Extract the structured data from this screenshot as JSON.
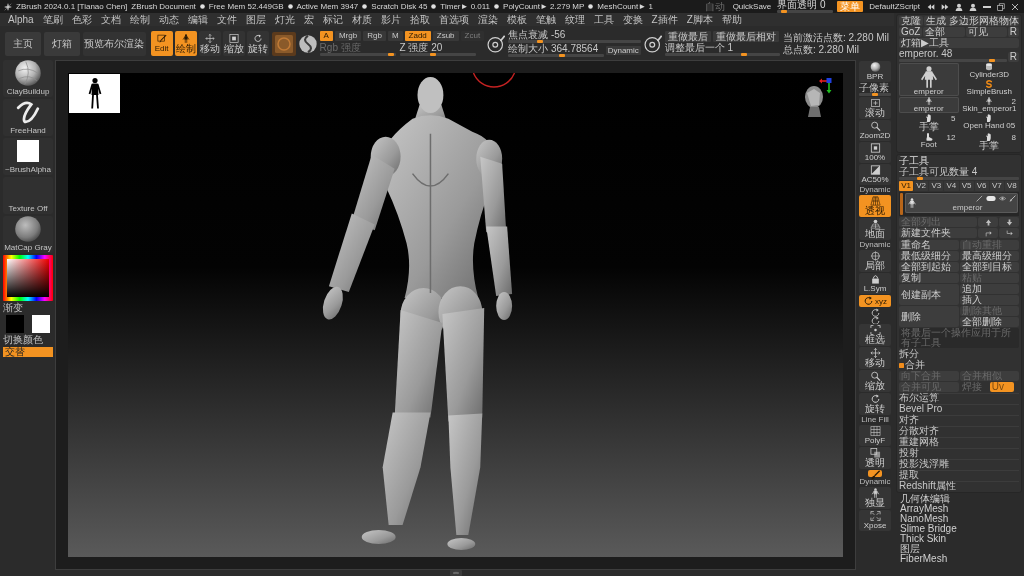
{
  "title_bar": {
    "app": "ZBrush 2024.0.1 [Tianao Chen]",
    "document": "ZBrush Document",
    "stats": [
      "Free Mem 52.449GB",
      "Active Mem 3947",
      "Scratch Disk 45",
      "Timer► 0.011",
      "PolyCount► 2.279 MP",
      "MeshCount► 1"
    ],
    "autosave": {
      "label": "自动",
      "disabled": true
    },
    "quicksave": "QuickSave",
    "transparency": {
      "label": "界面透明 0",
      "level": 0.07
    },
    "menu_button": {
      "label": "菜单",
      "selected": true
    },
    "script": "DefaultZScript"
  },
  "menus": [
    "Alpha",
    "笔刷",
    "色彩",
    "文档",
    "绘制",
    "动态",
    "编辑",
    "文件",
    "图层",
    "灯光",
    "宏",
    "标记",
    "材质",
    "影片",
    "拾取",
    "首选项",
    "渲染",
    "模板",
    "笔触",
    "纹理",
    "工具",
    "变换",
    "Z插件",
    "Z脚本",
    "帮助"
  ],
  "top_shelf": {
    "buttons": [
      "主页",
      "灯箱",
      "预览布尔渲染"
    ],
    "modes": [
      {
        "kind": "edit",
        "label": "Edit",
        "selected": true
      },
      {
        "kind": "draw",
        "label": "绘制",
        "selected": true
      },
      {
        "kind": "move",
        "label": "移动",
        "selected": false
      },
      {
        "kind": "scale",
        "label": "缩放",
        "selected": false
      },
      {
        "kind": "rotate",
        "label": "旋转",
        "selected": false
      }
    ],
    "channels": [
      {
        "label": "A",
        "selected": true
      },
      {
        "label": "Mrgb",
        "selected": false
      },
      {
        "label": "Rgb",
        "selected": false
      },
      {
        "label": "M",
        "selected": false
      }
    ],
    "z_modes": [
      {
        "label": "Zadd",
        "selected": true,
        "disabled": false
      },
      {
        "label": "Zsub",
        "selected": false,
        "disabled": false
      },
      {
        "label": "Zcut",
        "selected": false,
        "disabled": true
      }
    ],
    "rgb_intensity": {
      "label": "Rgb 强度",
      "level": 0.97,
      "disabled": true
    },
    "z_intensity": {
      "label": "Z 强度 20",
      "level": 0.43,
      "disabled": false
    },
    "focal_shift": {
      "label": "焦点衰减 -56",
      "level": 0.23
    },
    "draw_size": {
      "label": "绘制大小 364.78564",
      "level": 0.57
    },
    "dynamic": {
      "label": "Dynamic",
      "on": false
    },
    "redo": [
      "重做最后",
      "重做最后相对"
    ],
    "tweak_last": {
      "label": "调整最后一个 1",
      "level": 0.7
    },
    "active_points": "当前激活点数: 2.280 Mil",
    "total_points": "总点数: 2.280 Mil"
  },
  "left_shelf": {
    "brush": "ClayBuildup",
    "stroke": "FreeHand",
    "alpha": "~BrushAlpha",
    "texture": "Texture Off",
    "material": "MatCap Gray",
    "gradient": "渐变",
    "switch_color": "切换颜色",
    "alternate": {
      "label": "交替",
      "on": true
    }
  },
  "right_shelf": [
    {
      "kind": "bpr",
      "label": "BPR",
      "selected": false,
      "slider": {
        "label": "子像素",
        "level": 0.5
      }
    },
    {
      "kind": "scroll",
      "label": "滚动",
      "selected": false
    },
    {
      "kind": "zoom",
      "label": "Zoom2D",
      "selected": false
    },
    {
      "kind": "actual",
      "label": "100%",
      "selected": false
    },
    {
      "kind": "aahalf",
      "label": "AC50%",
      "selected": false
    },
    {
      "kind": "persp",
      "caption": "Dynamic",
      "label": "透视",
      "selected": true
    },
    {
      "kind": "floor",
      "label": "地面",
      "selected": false
    },
    {
      "kind": "local",
      "caption": "Dynamic",
      "label": "局部",
      "selected": false
    },
    {
      "kind": "lsym",
      "label": "L.Sym",
      "selected": false
    },
    {
      "kind": "xyz",
      "label": "xyz",
      "selected": true
    },
    {
      "kind": "rot-y",
      "selected": false
    },
    {
      "kind": "rot-z",
      "selected": false
    },
    {
      "kind": "frame",
      "label": "框选",
      "selected": false
    },
    {
      "kind": "move",
      "label": "移动",
      "selected": false
    },
    {
      "kind": "zoom3d",
      "label": "缩放",
      "selected": false
    },
    {
      "kind": "rotate",
      "label": "旋转",
      "selected": false
    },
    {
      "kind": "polyf",
      "caption": "Line Fill",
      "label": "PolyF",
      "selected": false
    },
    {
      "kind": "transp",
      "label": "透明",
      "selected": false
    },
    {
      "kind": "ghost",
      "selected": true
    },
    {
      "kind": "solo",
      "caption": "Dynamic",
      "label": "独显",
      "selected": false
    },
    {
      "kind": "xpose",
      "label": "Xpose",
      "selected": false
    }
  ],
  "tool_panel": {
    "clone": "克隆",
    "make_polymesh": "生成 多边形网格物体",
    "goz": "GoZ",
    "all": "全部",
    "visible": "可见",
    "goz_r": "R",
    "lightbox": "灯箱▶工具",
    "tool_slider": {
      "label": "emperor. 48",
      "level": 0.88
    },
    "slider_r": "R",
    "tools": [
      {
        "kind": "figure",
        "label": "emperor",
        "selected": true
      },
      {
        "kind": "cylinder",
        "label": "Cylinder3D",
        "selected": false
      },
      {
        "kind": "simplebrush",
        "label": "SimpleBrush",
        "selected": false
      },
      {
        "kind": "figure",
        "label": "emperor",
        "selected": true
      },
      {
        "kind": "figure",
        "label": "Skin_emperor1",
        "count": "2",
        "selected": false
      },
      {
        "kind": "hand",
        "label": "手掌",
        "count": "5",
        "selected": false
      },
      {
        "kind": "hand",
        "label": "Open Hand 05",
        "selected": false
      },
      {
        "kind": "foot",
        "label": "Foot",
        "count": "12",
        "selected": false
      },
      {
        "kind": "hand",
        "label": "手掌",
        "count": "8",
        "selected": false
      }
    ]
  },
  "subtool_panel": {
    "title": "子工具",
    "visible_count": {
      "label": "子工具可见数量 4",
      "level": 0.16
    },
    "versions": [
      {
        "label": "V1",
        "selected": true
      },
      {
        "label": "V2",
        "selected": false
      },
      {
        "label": "V3",
        "selected": false
      },
      {
        "label": "V4",
        "selected": false
      },
      {
        "label": "V5",
        "selected": false
      },
      {
        "label": "V6",
        "selected": false
      },
      {
        "label": "V7",
        "selected": false
      },
      {
        "label": "V8",
        "selected": false
      }
    ],
    "subtools": [
      {
        "name": "emperor",
        "selected": true
      }
    ],
    "list_all": {
      "label": "全部列出",
      "disabled": true
    },
    "new_folder": "新建文件夹",
    "actions": [
      {
        "kind": "normal",
        "label": "重命名",
        "disabled": false
      },
      {
        "kind": "normal",
        "label": "自动重排",
        "disabled": true
      },
      {
        "kind": "normal",
        "label": "最低级细分",
        "disabled": false
      },
      {
        "kind": "normal",
        "label": "最高级细分",
        "disabled": false
      },
      {
        "kind": "normal",
        "label": "全部到起始",
        "disabled": false
      },
      {
        "kind": "normal",
        "label": "全部到目标",
        "disabled": false
      },
      {
        "kind": "normal",
        "label": "复制",
        "disabled": false
      },
      {
        "kind": "normal",
        "label": "粘贴",
        "disabled": true
      },
      {
        "kind": "tall",
        "label": "创建副本",
        "disabled": false
      },
      {
        "kind": "normal",
        "label": "追加",
        "disabled": false
      },
      {
        "kind": "normal",
        "label": "插入",
        "disabled": false
      },
      {
        "kind": "tall",
        "label": "删除",
        "disabled": false
      },
      {
        "kind": "normal",
        "label": "删除其他",
        "disabled": true
      },
      {
        "kind": "normal",
        "label": "全部删除",
        "disabled": false
      }
    ],
    "apply_all": {
      "label": "将最后一个操作应用于所有子工具",
      "disabled": true
    },
    "sections": [
      {
        "label": "拆分",
        "expanded": false
      },
      {
        "label": "合并",
        "expanded": true,
        "buttons": [
          {
            "kind": "button",
            "label": "向下合并",
            "disabled": true
          },
          {
            "kind": "button",
            "label": "合并相似",
            "disabled": true
          },
          {
            "kind": "button",
            "label": "合并可见",
            "disabled": true
          },
          {
            "kind": "toggle",
            "label": "焊接",
            "disabled": true
          },
          {
            "kind": "switch",
            "label": "Uv",
            "disabled": false
          }
        ]
      },
      {
        "label": "布尔运算",
        "expanded": false
      },
      {
        "label": "Bevel Pro",
        "expanded": false
      },
      {
        "label": "对齐",
        "expanded": false
      },
      {
        "label": "分散对齐",
        "expanded": false
      },
      {
        "label": "重建网格",
        "expanded": false
      },
      {
        "label": "投射",
        "expanded": false
      },
      {
        "label": "投影浅浮雕",
        "expanded": false
      },
      {
        "label": "提取",
        "expanded": false
      },
      {
        "label": "Redshift属性",
        "expanded": false
      }
    ]
  },
  "geometry_list": [
    "几何体编辑",
    "ArrayMesh",
    "NanoMesh",
    "Slime Bridge",
    "Thick Skin",
    "图层",
    "FiberMesh"
  ]
}
